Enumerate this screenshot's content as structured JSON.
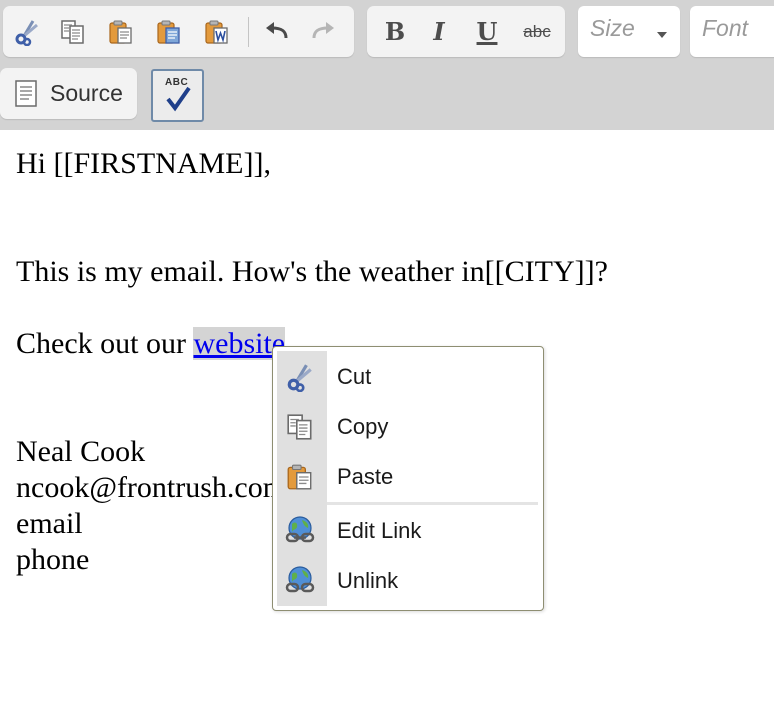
{
  "toolbar": {
    "clipboard_buttons": [
      {
        "name": "cut-button",
        "icon": "scissors-icon"
      },
      {
        "name": "copy-button",
        "icon": "copy-icon"
      },
      {
        "name": "paste-button",
        "icon": "paste-icon"
      },
      {
        "name": "paste-text-button",
        "icon": "paste-text-icon"
      },
      {
        "name": "paste-word-button",
        "icon": "paste-word-icon"
      }
    ],
    "history_buttons": [
      {
        "name": "undo-button",
        "icon": "undo-icon"
      },
      {
        "name": "redo-button",
        "icon": "redo-icon"
      }
    ],
    "format": {
      "bold": "B",
      "italic": "I",
      "underline": "U",
      "strike": "abc"
    },
    "size_placeholder": "Size",
    "font_placeholder": "Font",
    "source_label": "Source",
    "spellcheck_label": "ABC"
  },
  "editor": {
    "greeting": "Hi [[FIRSTNAME]],",
    "body_line": "This is my email. How's the weather in[[CITY]]?",
    "check_prefix": "Check out our ",
    "link_text": "website",
    "link_suffix": ".",
    "signature_name": "Neal Cook",
    "signature_email": "ncook@frontrush.com",
    "signature_line3": "email",
    "signature_line4": "phone"
  },
  "context_menu": {
    "items": [
      {
        "label": "Cut",
        "icon": "scissors-icon"
      },
      {
        "label": "Copy",
        "icon": "copy-icon"
      },
      {
        "label": "Paste",
        "icon": "paste-icon"
      },
      {
        "label": "Edit Link",
        "icon": "link-globe-icon"
      },
      {
        "label": "Unlink",
        "icon": "unlink-globe-icon"
      }
    ]
  },
  "colors": {
    "toolbar_bg": "#d3d3d3",
    "link": "#0000ee",
    "menu_border": "#8e8e72"
  }
}
